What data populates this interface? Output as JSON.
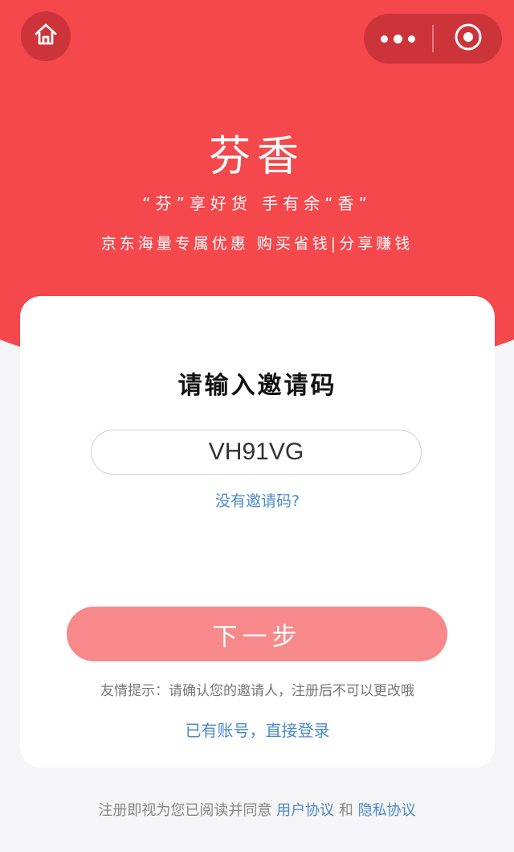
{
  "header": {
    "home_icon": "home-icon",
    "more_icon": "more-dots-icon",
    "close_icon": "target-icon"
  },
  "brand": {
    "name": "芬香",
    "slogan": "“芬”享好货  手有余“香”",
    "subslogan": "京东海量专属优惠  购买省钱|分享赚钱"
  },
  "card": {
    "title": "请输入邀请码",
    "code_value": "VH91VG",
    "no_code_link": "没有邀请码?",
    "next_button": "下一步",
    "tip": "友情提示：请确认您的邀请人，注册后不可以更改哦",
    "login_link": "已有账号，直接登录"
  },
  "footer": {
    "prefix": "注册即视为您已阅读并同意 ",
    "user_agreement": "用户协议",
    "and": " 和 ",
    "privacy_agreement": "隐私协议"
  },
  "colors": {
    "brand_red": "#f4484d",
    "button_pink": "#f7898a",
    "link_blue": "#4a8ac9"
  }
}
